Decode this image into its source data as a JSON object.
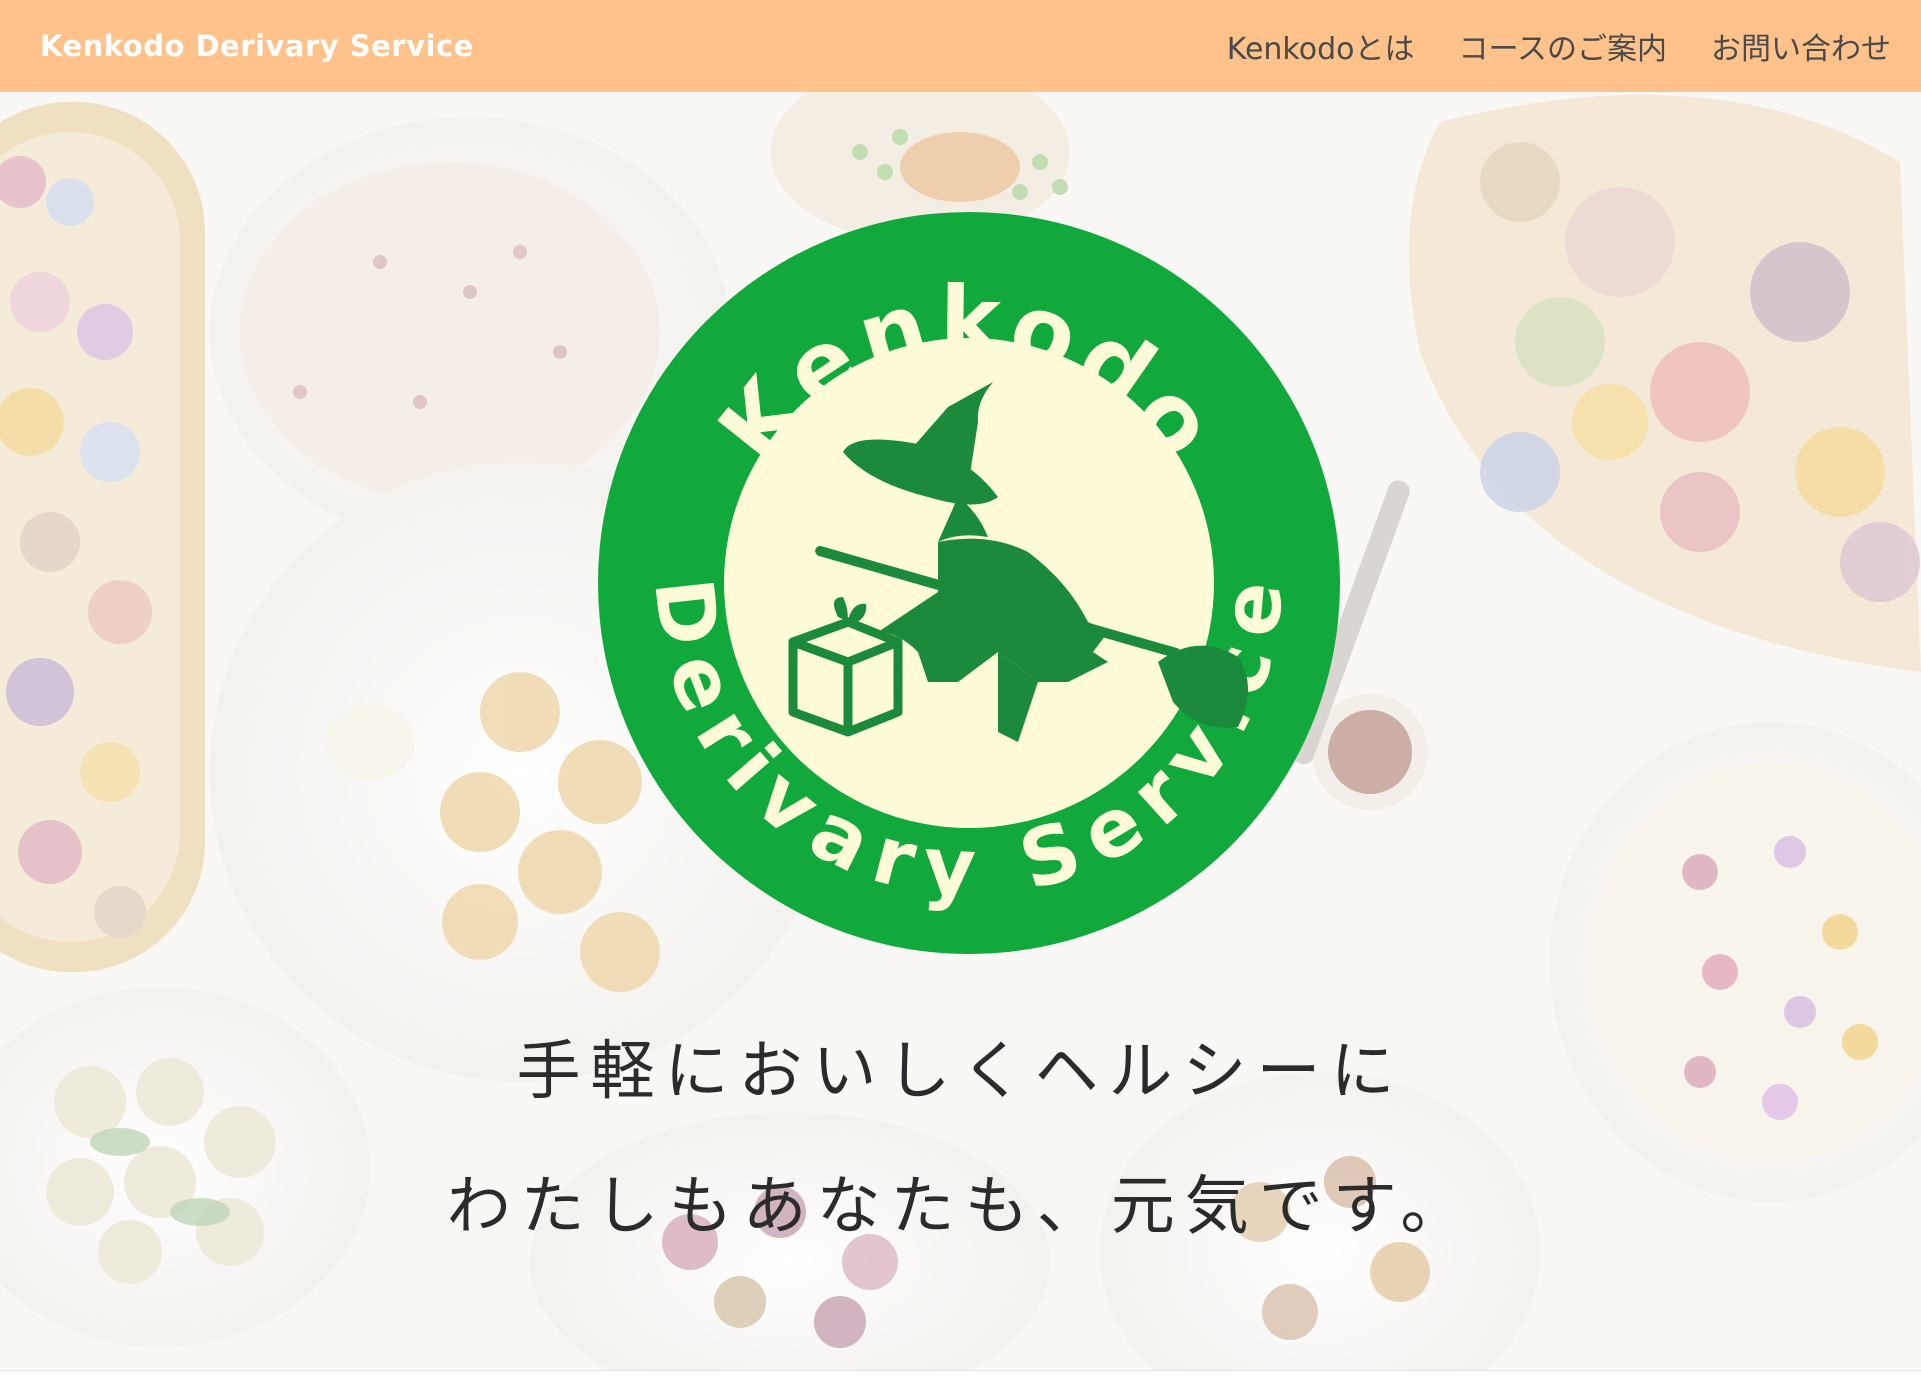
{
  "header": {
    "brand": "Kenkodo Derivary Service",
    "nav": [
      {
        "label": "Kenkodoとは"
      },
      {
        "label": "コースのご案内"
      },
      {
        "label": "お問い合わせ"
      }
    ]
  },
  "logo": {
    "top_text": "Kenkodo",
    "bottom_text": "Derivary Service",
    "ring_color": "#11a83c",
    "inner_color": "#fefcd8",
    "figure_color": "#1b8b3b"
  },
  "hero": {
    "tagline_line1": "手軽においしくヘルシーに",
    "tagline_line2": "わたしもあなたも、元気です。",
    "background_image": "food-spread-photo"
  },
  "colors": {
    "header_bg": "#fec28a",
    "brand_text": "#ffffff",
    "nav_text": "#4a4a4a"
  }
}
